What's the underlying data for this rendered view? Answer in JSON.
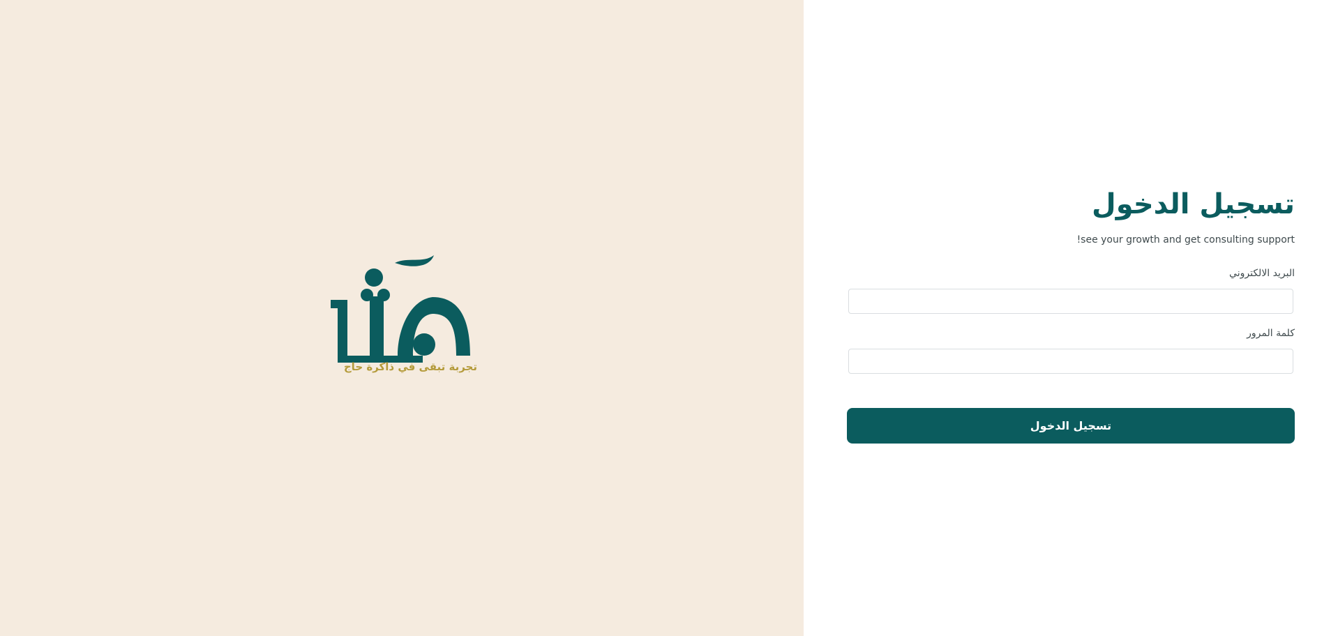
{
  "brand": {
    "tagline": "تجربة تبقى في ذاكرة حاج",
    "wordmark": "مآثر",
    "icon": "maather-logo",
    "colors": {
      "background": "#f5ebdf",
      "primary": "#0b5c5e",
      "accent": "#b49b3b"
    }
  },
  "login": {
    "title": "تسجيل الدخول",
    "subtitle": "!see your growth and get consulting support",
    "email_label": "البريد الالكتروني",
    "email_value": "",
    "password_label": "كلمة المرور",
    "password_value": "",
    "submit_label": "تسجيل الدخول"
  }
}
